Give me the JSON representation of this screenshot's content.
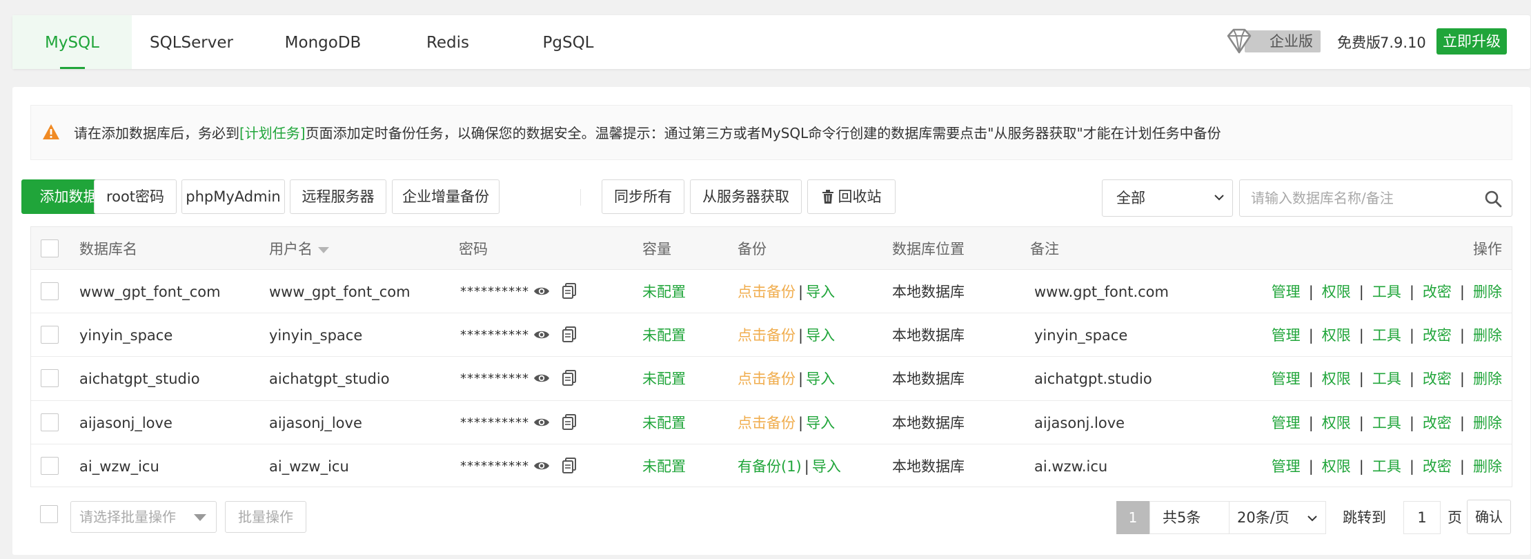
{
  "tabs": [
    {
      "label": "MySQL",
      "active": true
    },
    {
      "label": "SQLServer",
      "active": false
    },
    {
      "label": "MongoDB",
      "active": false
    },
    {
      "label": "Redis",
      "active": false
    },
    {
      "label": "PgSQL",
      "active": false
    }
  ],
  "header": {
    "enterprise_label": "企业版",
    "free_label": "免费版",
    "version": "7.9.10",
    "upgrade_label": "立即升级"
  },
  "notice": {
    "before": "请在添加数据库后，务必到",
    "link": "[计划任务]",
    "after": "页面添加定时备份任务，以确保您的数据安全。温馨提示：通过第三方或者MySQL命令行创建的数据库需要点击\"从服务器获取\"才能在计划任务中备份"
  },
  "toolbar": {
    "add_db": "添加数据库",
    "root_pwd": "root密码",
    "phpmyadmin": "phpMyAdmin",
    "remote_server": "远程服务器",
    "enterprise_backup": "企业增量备份",
    "sync_all": "同步所有",
    "fetch_from_server": "从服务器获取",
    "recycle_bin": "回收站"
  },
  "filter": {
    "selected": "全部",
    "search_placeholder": "请输入数据库名称/备注"
  },
  "table": {
    "headers": {
      "name": "数据库名",
      "user": "用户名",
      "password": "密码",
      "capacity": "容量",
      "backup": "备份",
      "location": "数据库位置",
      "note": "备注",
      "actions": "操作"
    },
    "rows": [
      {
        "name": "www_gpt_font_com",
        "user": "www_gpt_font_com",
        "password": "**********",
        "capacity": "未配置",
        "backup": "点击备份",
        "import": "导入",
        "location": "本地数据库",
        "note": "www.gpt_font.com"
      },
      {
        "name": "yinyin_space",
        "user": "yinyin_space",
        "password": "**********",
        "capacity": "未配置",
        "backup": "点击备份",
        "import": "导入",
        "location": "本地数据库",
        "note": "yinyin_space"
      },
      {
        "name": "aichatgpt_studio",
        "user": "aichatgpt_studio",
        "password": "**********",
        "capacity": "未配置",
        "backup": "点击备份",
        "import": "导入",
        "location": "本地数据库",
        "note": "aichatgpt.studio"
      },
      {
        "name": "aijasonj_love",
        "user": "aijasonj_love",
        "password": "**********",
        "capacity": "未配置",
        "backup": "点击备份",
        "import": "导入",
        "location": "本地数据库",
        "note": "aijasonj.love"
      },
      {
        "name": "ai_wzw_icu",
        "user": "ai_wzw_icu",
        "password": "**********",
        "capacity": "未配置",
        "backup": "有备份(1)",
        "import": "导入",
        "location": "本地数据库",
        "note": "ai.wzw.icu"
      }
    ],
    "actions": {
      "manage": "管理",
      "permission": "权限",
      "tools": "工具",
      "change_pwd": "改密",
      "delete": "删除",
      "separator": "|"
    }
  },
  "footer": {
    "batch_placeholder": "请选择批量操作",
    "batch_button": "批量操作",
    "current_page": "1",
    "total": "共5条",
    "page_size": "20条/页",
    "jump_to": "跳转到",
    "jump_value": "1",
    "page_unit": "页",
    "confirm": "确认"
  },
  "colors": {
    "accent": "#20a53a",
    "backup_link": "#f0ad4e"
  }
}
